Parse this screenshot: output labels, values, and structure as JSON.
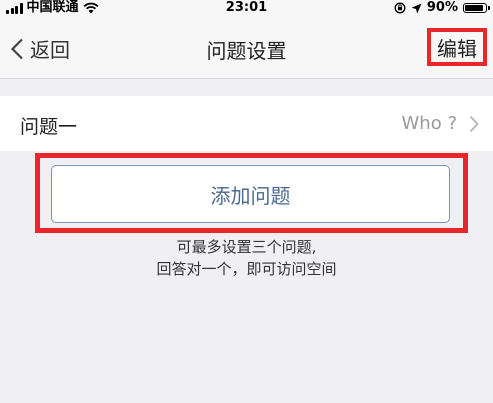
{
  "status_bar": {
    "carrier": "中国联通",
    "time": "23:01",
    "battery": "90%",
    "battery_level": 0.9
  },
  "nav": {
    "back_label": "返回",
    "title": "问题设置",
    "edit_label": "编辑"
  },
  "question_row": {
    "label": "问题一",
    "value": "Who ?"
  },
  "add_button": {
    "label": "添加问题"
  },
  "hint": {
    "line1": "可最多设置三个问题,",
    "line2": "回答对一个，即可访问空间"
  },
  "colors": {
    "highlight": "#e8262b",
    "accent": "#4a6a92"
  },
  "icons": [
    "signal-icon",
    "wifi-icon",
    "lock-rotation-icon",
    "location-icon",
    "battery-icon",
    "back-chevron-icon",
    "chevron-right-icon"
  ]
}
